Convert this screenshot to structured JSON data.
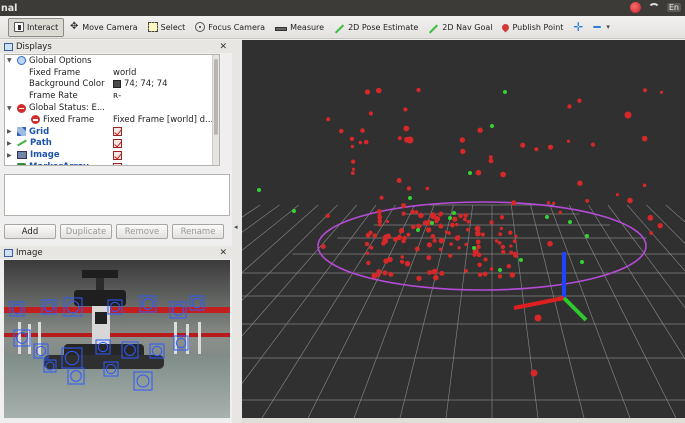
{
  "window": {
    "title": "nal"
  },
  "tray": {
    "language": "En",
    "icons": [
      "rviz-record-icon",
      "wifi-icon",
      "sound-icon"
    ]
  },
  "toolbar": {
    "tools": [
      {
        "label": "Interact",
        "icon": "interact-icon",
        "active": true
      },
      {
        "label": "Move Camera",
        "icon": "move-camera-icon",
        "active": false
      },
      {
        "label": "Select",
        "icon": "select-icon",
        "active": false
      },
      {
        "label": "Focus Camera",
        "icon": "focus-camera-icon",
        "active": false
      },
      {
        "label": "Measure",
        "icon": "measure-icon",
        "active": false
      },
      {
        "label": "2D Pose Estimate",
        "icon": "pose-estimate-icon",
        "active": false
      },
      {
        "label": "2D Nav Goal",
        "icon": "nav-goal-icon",
        "active": false
      },
      {
        "label": "Publish Point",
        "icon": "publish-point-icon",
        "active": false
      }
    ]
  },
  "displays": {
    "title": "Displays",
    "rows": [
      {
        "name": "Global Options",
        "value": "",
        "icon": "globe-icon",
        "indent": 0,
        "expand": "expanded"
      },
      {
        "name": "Fixed Frame",
        "value": "world",
        "icon": "",
        "indent": 1,
        "expand": ""
      },
      {
        "name": "Background Color",
        "value": "74; 74; 74",
        "icon": "",
        "indent": 1,
        "expand": "",
        "swatch": "#4a4a4a"
      },
      {
        "name": "Frame Rate",
        "value": "ʀ-",
        "icon": "",
        "indent": 1,
        "expand": ""
      },
      {
        "name": "Global Status: E...",
        "value": "",
        "icon": "error-icon",
        "indent": 0,
        "expand": "expanded"
      },
      {
        "name": "Fixed Frame",
        "value": "Fixed Frame [world] d...",
        "icon": "error-icon",
        "indent": 1,
        "expand": ""
      },
      {
        "name": "Grid",
        "value": "",
        "icon": "grid-icon",
        "indent": 0,
        "expand": "collapsed",
        "checked": true,
        "blue": true
      },
      {
        "name": "Path",
        "value": "",
        "icon": "path-icon",
        "indent": 0,
        "expand": "collapsed",
        "checked": true,
        "blue": true
      },
      {
        "name": "Image",
        "value": "",
        "icon": "image-icon",
        "indent": 0,
        "expand": "collapsed",
        "checked": true,
        "blue": true
      },
      {
        "name": "MarkerArray",
        "value": "",
        "icon": "marker-icon",
        "indent": 0,
        "expand": "collapsed",
        "checked": true,
        "blue": true
      }
    ],
    "buttons": [
      {
        "label": "Add",
        "enabled": true
      },
      {
        "label": "Duplicate",
        "enabled": false
      },
      {
        "label": "Remove",
        "enabled": false
      },
      {
        "label": "Rename",
        "enabled": false
      }
    ]
  },
  "image_panel": {
    "title": "Image"
  },
  "colors": {
    "background_3d": "#303030",
    "grid": "#9a9a9a",
    "feature_points": "#d62828",
    "green_points": "#35d135",
    "ellipse": "#b54bd6"
  }
}
